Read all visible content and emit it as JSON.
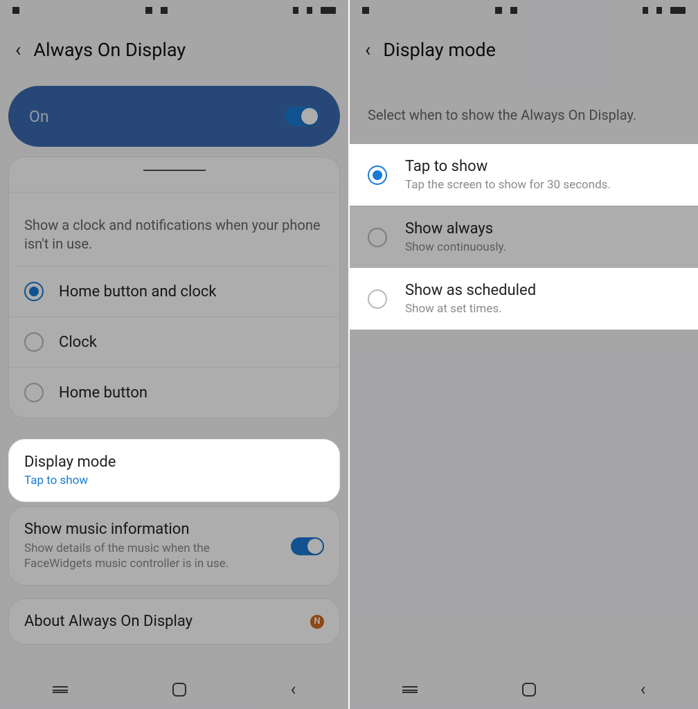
{
  "left": {
    "title": "Always On Display",
    "toggle_label": "On",
    "clock_desc": "Show a clock and notifications when your phone isn't in use.",
    "radios": {
      "opt1": "Home button and clock",
      "opt2": "Clock",
      "opt3": "Home button"
    },
    "display_mode": {
      "title": "Display mode",
      "value": "Tap to show"
    },
    "music": {
      "title": "Show music information",
      "desc": "Show details of the music when the FaceWidgets music controller is in use."
    },
    "about": {
      "title": "About Always On Display",
      "badge": "N"
    }
  },
  "right": {
    "title": "Display mode",
    "intro": "Select when to show the Always On Display.",
    "opts": {
      "o1": {
        "t": "Tap to show",
        "s": "Tap the screen to show for 30 seconds."
      },
      "o2": {
        "t": "Show always",
        "s": "Show continuously."
      },
      "o3": {
        "t": "Show as scheduled",
        "s": "Show at set times."
      }
    }
  }
}
